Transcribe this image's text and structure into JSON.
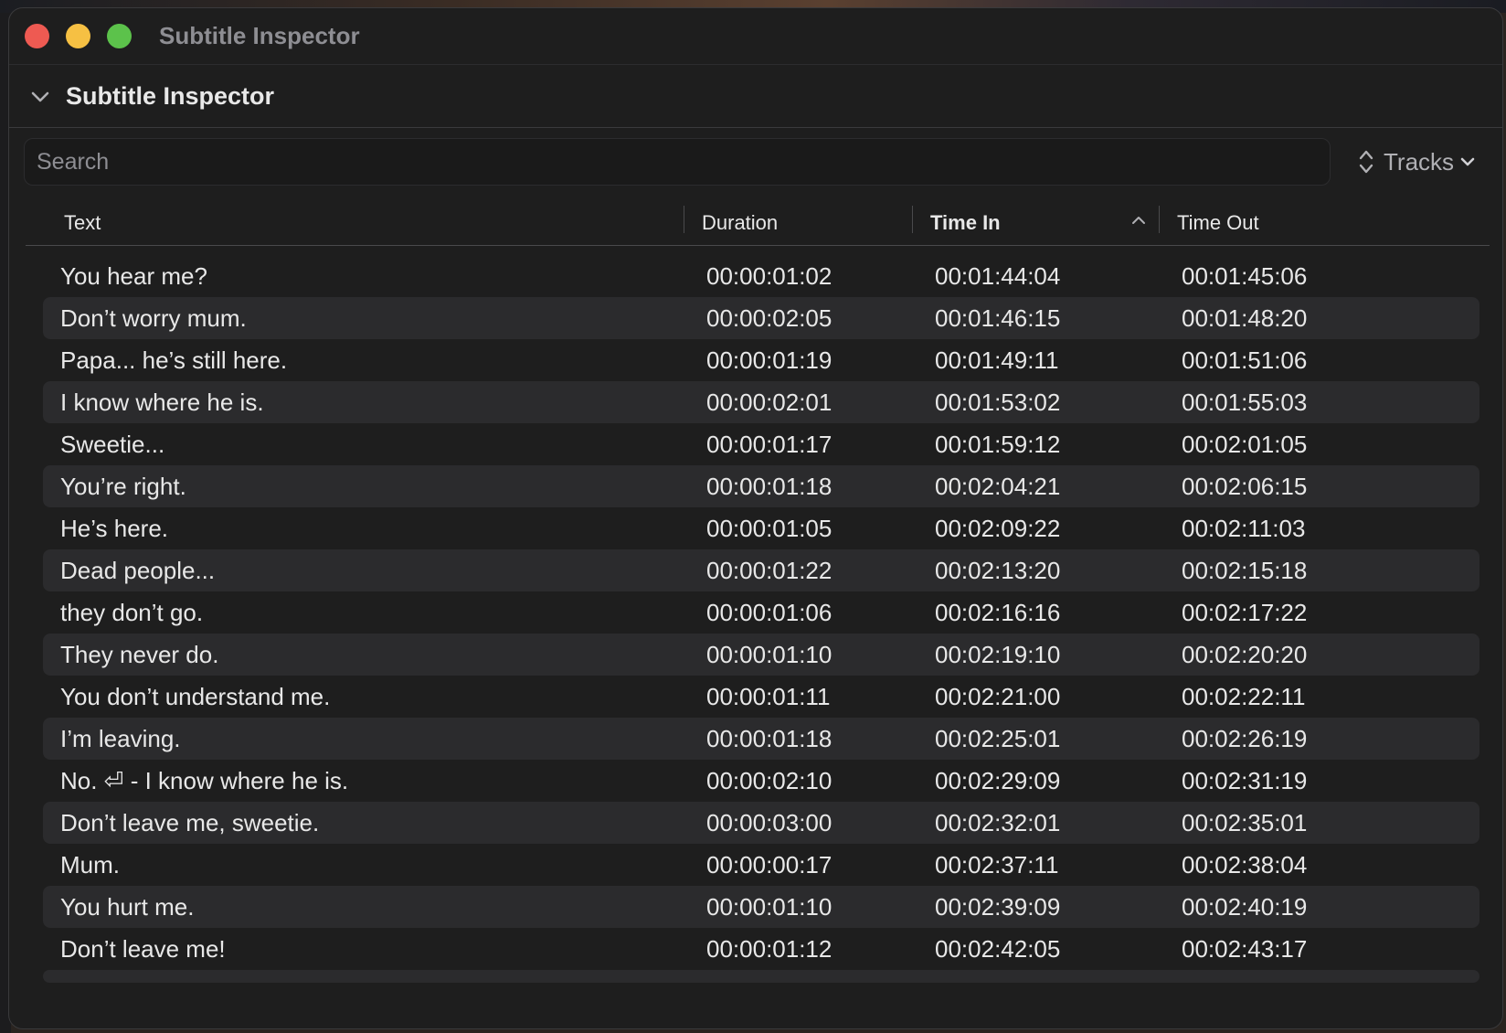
{
  "window": {
    "title": "Subtitle Inspector"
  },
  "inspector": {
    "title": "Subtitle Inspector"
  },
  "search": {
    "placeholder": "Search",
    "value": ""
  },
  "tracks_menu": {
    "label": "Tracks"
  },
  "columns": {
    "text": "Text",
    "duration": "Duration",
    "time_in": "Time In",
    "time_out": "Time Out",
    "sorted_by": "Time In",
    "sort_direction": "ascending"
  },
  "icons": {
    "disclosure": "chevron-down-icon",
    "tracks_popup": "up-down-chevron-icon",
    "tracks_dropdown": "chevron-down-icon",
    "sort": "chevron-up-icon"
  },
  "colors": {
    "window_bg": "#1e1e1e",
    "alt_row_bg": "#2b2b2d",
    "close": "#ee5a52",
    "minimize": "#f6c043",
    "zoom": "#5cc24b"
  },
  "rows": [
    {
      "text": "You hear me?",
      "duration": "00:00:01:02",
      "time_in": "00:01:44:04",
      "time_out": "00:01:45:06"
    },
    {
      "text": "Don’t worry mum.",
      "duration": "00:00:02:05",
      "time_in": "00:01:46:15",
      "time_out": "00:01:48:20"
    },
    {
      "text": "Papa... he’s still here.",
      "duration": "00:00:01:19",
      "time_in": "00:01:49:11",
      "time_out": "00:01:51:06"
    },
    {
      "text": "I know where he is.",
      "duration": "00:00:02:01",
      "time_in": "00:01:53:02",
      "time_out": "00:01:55:03"
    },
    {
      "text": "Sweetie...",
      "duration": "00:00:01:17",
      "time_in": "00:01:59:12",
      "time_out": "00:02:01:05"
    },
    {
      "text": "You’re right.",
      "duration": "00:00:01:18",
      "time_in": "00:02:04:21",
      "time_out": "00:02:06:15"
    },
    {
      "text": "He’s here.",
      "duration": "00:00:01:05",
      "time_in": "00:02:09:22",
      "time_out": "00:02:11:03"
    },
    {
      "text": "Dead people...",
      "duration": "00:00:01:22",
      "time_in": "00:02:13:20",
      "time_out": "00:02:15:18"
    },
    {
      "text": "they don’t go.",
      "duration": "00:00:01:06",
      "time_in": "00:02:16:16",
      "time_out": "00:02:17:22"
    },
    {
      "text": "They never do.",
      "duration": "00:00:01:10",
      "time_in": "00:02:19:10",
      "time_out": "00:02:20:20"
    },
    {
      "text": "You don’t understand me.",
      "duration": "00:00:01:11",
      "time_in": "00:02:21:00",
      "time_out": "00:02:22:11"
    },
    {
      "text": "I’m leaving.",
      "duration": "00:00:01:18",
      "time_in": "00:02:25:01",
      "time_out": "00:02:26:19"
    },
    {
      "text": "No. ⏎ - I know where he is.",
      "duration": "00:00:02:10",
      "time_in": "00:02:29:09",
      "time_out": "00:02:31:19"
    },
    {
      "text": "Don’t leave me, sweetie.",
      "duration": "00:00:03:00",
      "time_in": "00:02:32:01",
      "time_out": "00:02:35:01"
    },
    {
      "text": "Mum.",
      "duration": "00:00:00:17",
      "time_in": "00:02:37:11",
      "time_out": "00:02:38:04"
    },
    {
      "text": "You hurt me.",
      "duration": "00:00:01:10",
      "time_in": "00:02:39:09",
      "time_out": "00:02:40:19"
    },
    {
      "text": "Don’t leave me!",
      "duration": "00:00:01:12",
      "time_in": "00:02:42:05",
      "time_out": "00:02:43:17"
    }
  ]
}
